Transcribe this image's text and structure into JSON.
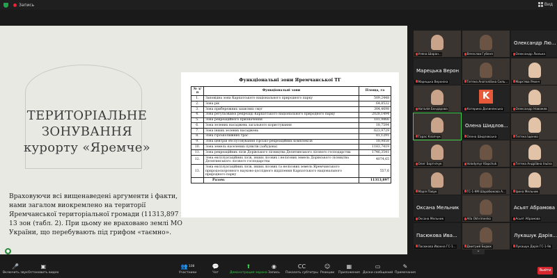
{
  "topbar": {
    "recording": "Запись",
    "view": "Вид"
  },
  "slide": {
    "title_lines": [
      "ТЕРИТОРІАЛЬНЕ",
      "ЗОНУВАННЯ",
      "курорту «Яремче»"
    ],
    "body": "Враховуючи всі вищенаведені аргументи і факти, нами загалом виокремлено на території Яремчанської територіальної громади (11313,897 га) 13 зон (табл. 2). При цьому не враховано землі МО України, що перебувають під грифом «таємно».",
    "table": {
      "title": "Функціональні зони Яремчанської ТГ",
      "headers": [
        "№ з/п",
        "Функціональні зони",
        "Площа, га"
      ],
      "rows": [
        [
          "1.",
          "Заповідна зона Карпатського національного природного парку",
          "509,2448"
        ],
        [
          "2.",
          "Зона рік",
          "64,8532"
        ],
        [
          "3.",
          "Зона прибережних захисних смуг",
          "304,4698"
        ],
        [
          "4.",
          "Зона регульованої рекреації Карпатського національного природного парку",
          "2028,1494"
        ],
        [
          "5.",
          "Зона рекреаційного призначення",
          "101,9866"
        ],
        [
          "6.",
          "Зона зелених насаджень загального користування",
          "18,7594"
        ],
        [
          "7.",
          "Зона інших зелених насаджень",
          "623,9729"
        ],
        [
          "8.",
          "Зона гірськолижних трас",
          "81,1291"
        ],
        [
          "9.",
          "Зона центрів обслуговування гірсько-рекреаційних комплексів",
          "18,9858"
        ],
        [
          "10.",
          "Зона земель населених пунктів (забудова)",
          "1183,7419"
        ],
        [
          "11.",
          "Зона рекреаційних лісів Дорівського лісництва Делятинського лісового господарства",
          "1746,3541"
        ],
        [
          "12.",
          "Зона експлуатаційних лісів, інших лісових і нелісових земель Дорівського лісництва Делятинського лісового господарства",
          "4074,65"
        ],
        [
          "13.",
          "Зона експлуатаційних лісів, інших лісових та нелісових земель Яремчанського природоохоронного науково-дослідного відділення Карпатського національного природного парку",
          "557,6"
        ]
      ],
      "total_label": "Разом:",
      "total_value": "11313,897"
    }
  },
  "participants": [
    {
      "label": "Уляна Шаран...",
      "kind": "video"
    },
    {
      "label": "Вячеслав Губеня",
      "kind": "video"
    },
    {
      "big": "Олександр Лю...",
      "label": "Олександр Люлька",
      "kind": "name"
    },
    {
      "big": "Марецька Верон...",
      "label": "Марецька Вероніка",
      "kind": "name"
    },
    {
      "label": "Тетяна Анатоліївна Силь...",
      "kind": "video"
    },
    {
      "label": "Марк'ява Ячинч",
      "kind": "video"
    },
    {
      "label": "Наталія Бондарова",
      "kind": "video"
    },
    {
      "label": "Катерина Долинянська",
      "kind": "logo",
      "logo": "K"
    },
    {
      "label": "Олександр Новожев",
      "kind": "video"
    },
    {
      "label": "Тарас Клапчук",
      "kind": "video",
      "active": true
    },
    {
      "big": "Олена Шидлов...",
      "label": "Олена Шидловська",
      "kind": "name"
    },
    {
      "label": "Тетяна Іщенко",
      "kind": "video"
    },
    {
      "label": "Олег Бортнічук",
      "kind": "video"
    },
    {
      "label": "Volodymyr Klapchuk",
      "kind": "video"
    },
    {
      "label": "Тетяна Андріївна Ільїна",
      "kind": "video"
    },
    {
      "label": "Марія Павук",
      "kind": "video"
    },
    {
      "label": "ГС-1-9М Шарабюкова А...",
      "kind": "video"
    },
    {
      "label": "Ірина Мельник",
      "kind": "video"
    },
    {
      "big": "Оксана Мельник",
      "label": "Оксана Мельник",
      "kind": "name"
    },
    {
      "label": "Alla Okhrimenko",
      "kind": "video"
    },
    {
      "big": "Асьят Абрамова",
      "label": "Асьят Абрамова",
      "kind": "name"
    },
    {
      "big": "Пасюкова Ива...",
      "label": "Пасюкова Иванна ГС-1...",
      "kind": "name"
    },
    {
      "label": "Дмитрий Бидюк",
      "kind": "video"
    },
    {
      "big": "Лукашук Дарія...",
      "label": "Лукашук Дарія ГС-1-9в",
      "kind": "name"
    }
  ],
  "toolbar": {
    "mute": "Включить звук",
    "video": "Остановить видео",
    "participants_count": "108",
    "participants": "Участники",
    "chat": "Чат",
    "share": "Демонстрация экрана",
    "record": "Запись",
    "captions": "Показать субтитры",
    "reactions": "Реакции",
    "apps": "Приложения",
    "whiteboards": "Доски сообщений",
    "notes": "Примечания",
    "leave": "Выйти"
  },
  "colors": {
    "accent_green": "#3bd14b",
    "leave_red": "#d8262f"
  }
}
